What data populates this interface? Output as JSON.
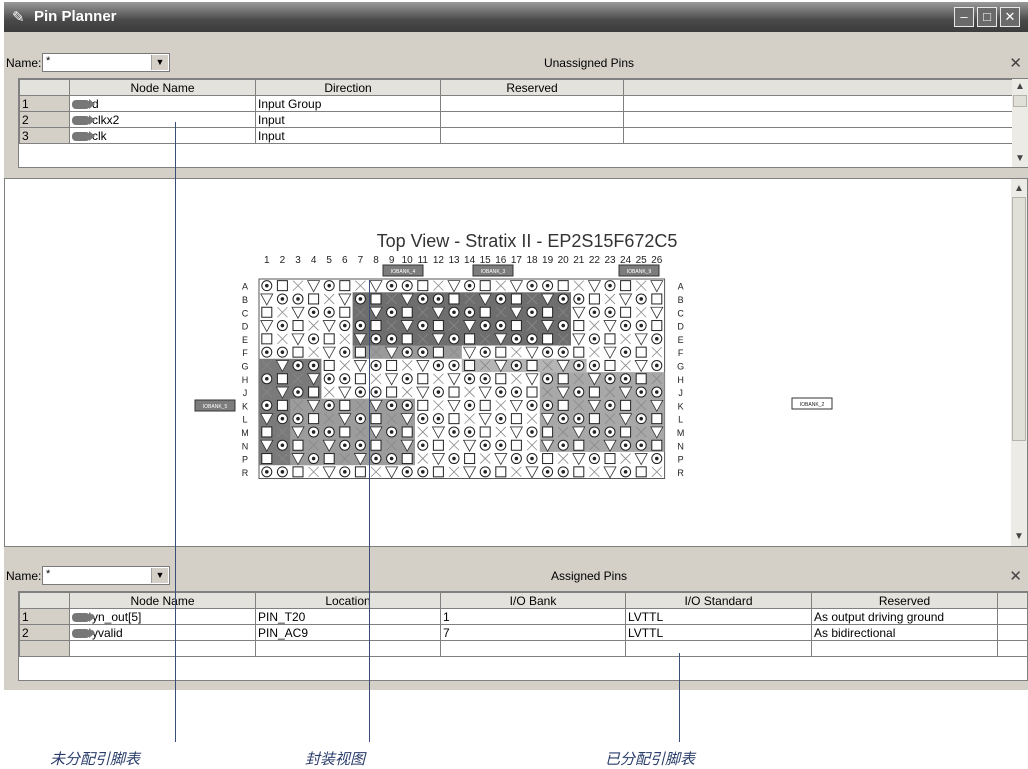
{
  "window": {
    "title": "Pin Planner",
    "buttons": [
      "–",
      "□",
      "✕"
    ]
  },
  "unassigned": {
    "name_label": "Name:",
    "filter_value": "*",
    "title": "Unassigned Pins",
    "columns": [
      "Node Name",
      "Direction",
      "Reserved"
    ],
    "rows": [
      {
        "num": "1",
        "node": "d",
        "direction": "Input Group",
        "reserved": ""
      },
      {
        "num": "2",
        "node": "clkx2",
        "direction": "Input",
        "reserved": ""
      },
      {
        "num": "3",
        "node": "clk",
        "direction": "Input",
        "reserved": ""
      }
    ]
  },
  "package": {
    "title": "Top View - Stratix II - EP2S15F672C5",
    "col_labels": [
      "1",
      "2",
      "3",
      "4",
      "5",
      "6",
      "7",
      "8",
      "9",
      "10",
      "11",
      "12",
      "13",
      "14",
      "15",
      "16",
      "17",
      "18",
      "19",
      "20",
      "21",
      "22",
      "23",
      "24",
      "25",
      "26"
    ],
    "row_labels": [
      "A",
      "B",
      "C",
      "D",
      "E",
      "F",
      "G",
      "H",
      "J",
      "K",
      "L",
      "M",
      "N",
      "P",
      "R"
    ],
    "banks": [
      "IOBANK_4",
      "IOBANK_3",
      "IOBANK_9",
      "IOBANK_5",
      "IOBANK_2"
    ]
  },
  "assigned": {
    "name_label": "Name:",
    "filter_value": "*",
    "title": "Assigned Pins",
    "columns": [
      "Node Name",
      "Location",
      "I/O Bank",
      "I/O Standard",
      "Reserved"
    ],
    "rows": [
      {
        "num": "1",
        "node": "yn_out[5]",
        "location": "PIN_T20",
        "bank": "1",
        "standard": "LVTTL",
        "reserved": "As output driving ground"
      },
      {
        "num": "2",
        "node": "yvalid",
        "location": "PIN_AC9",
        "bank": "7",
        "standard": "LVTTL",
        "reserved": "As bidirectional"
      }
    ]
  },
  "callouts": {
    "unassigned": "未分配引脚表",
    "package": "封装视图",
    "assigned": "已分配引脚表"
  }
}
